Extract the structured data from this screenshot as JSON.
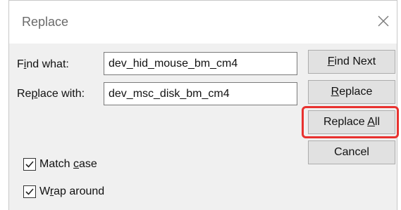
{
  "dialog": {
    "title": "Replace",
    "close_icon": "close-icon"
  },
  "find": {
    "label_pre": "F",
    "label_ul": "i",
    "label_post": "nd what:",
    "value": "dev_hid_mouse_bm_cm4"
  },
  "replace": {
    "label_pre": "Re",
    "label_ul": "p",
    "label_post": "lace with:",
    "value": "dev_msc_disk_bm_cm4"
  },
  "buttons": {
    "find_next": {
      "ul": "F",
      "post": "ind Next"
    },
    "replace": {
      "ul": "R",
      "post": "eplace"
    },
    "replace_all": {
      "pre": "Replace ",
      "ul": "A",
      "post": "ll"
    },
    "cancel": "Cancel"
  },
  "options": {
    "match_case": {
      "pre": "Match ",
      "ul": "c",
      "post": "ase",
      "checked": true
    },
    "wrap_around": {
      "pre": "W",
      "ul": "r",
      "post": "ap around",
      "checked": true
    }
  },
  "colors": {
    "highlight": "#e8322f"
  }
}
